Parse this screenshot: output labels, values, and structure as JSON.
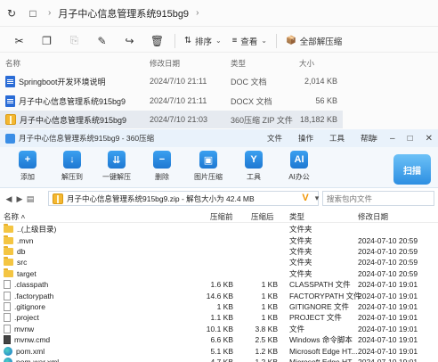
{
  "explorer": {
    "breadcrumb": [
      "月子中心信息管理系统915bg9"
    ],
    "toolbar": {
      "sort_label": "排序",
      "view_label": "查看",
      "extract_all_label": "全部解压缩"
    },
    "columns": [
      "名称",
      "修改日期",
      "类型",
      "大小"
    ],
    "files": [
      {
        "name": "Springboot开发环境说明",
        "date": "2024/7/10 21:11",
        "type": "DOC 文档",
        "size": "2,014 KB",
        "icon": "doc-icon"
      },
      {
        "name": "月子中心信息管理系统915bg9",
        "date": "2024/7/10 21:11",
        "type": "DOCX 文档",
        "size": "56 KB",
        "icon": "doc-icon"
      },
      {
        "name": "月子中心信息管理系统915bg9",
        "date": "2024/7/10 21:03",
        "type": "360压缩 ZIP 文件",
        "size": "18,182 KB",
        "icon": "zip-icon"
      }
    ]
  },
  "zipwin": {
    "title": "月子中心信息管理系统915bg9 - 360压缩",
    "menus": [
      "文件",
      "操作",
      "工具",
      "帮助"
    ],
    "tools": [
      "添加",
      "解压到",
      "一键解压",
      "删除",
      "图片压缩",
      "工具",
      "AI办公"
    ],
    "scan_label": "扫描",
    "path": "月子中心信息管理系统915bg9.zip - 解包大小为 42.4 MB",
    "search_placeholder": "搜索包内文件",
    "columns": [
      "名称",
      "压缩前",
      "压缩后",
      "类型",
      "修改日期"
    ],
    "rows": [
      {
        "name": "..(上级目录)",
        "before": "",
        "after": "",
        "type": "文件夹",
        "time": "",
        "kind": "folder"
      },
      {
        "name": ".mvn",
        "before": "",
        "after": "",
        "type": "文件夹",
        "time": "2024-07-10 20:59",
        "kind": "folder"
      },
      {
        "name": "db",
        "before": "",
        "after": "",
        "type": "文件夹",
        "time": "2024-07-10 20:59",
        "kind": "folder"
      },
      {
        "name": "src",
        "before": "",
        "after": "",
        "type": "文件夹",
        "time": "2024-07-10 20:59",
        "kind": "folder"
      },
      {
        "name": "target",
        "before": "",
        "after": "",
        "type": "文件夹",
        "time": "2024-07-10 20:59",
        "kind": "folder"
      },
      {
        "name": ".classpath",
        "before": "1.6 KB",
        "after": "1 KB",
        "type": "CLASSPATH 文件",
        "time": "2024-07-10 19:01",
        "kind": "file"
      },
      {
        "name": ".factorypath",
        "before": "14.6 KB",
        "after": "1 KB",
        "type": "FACTORYPATH 文件",
        "time": "2024-07-10 19:01",
        "kind": "file"
      },
      {
        "name": ".gitignore",
        "before": "1 KB",
        "after": "1 KB",
        "type": "GITIGNORE 文件",
        "time": "2024-07-10 19:01",
        "kind": "file"
      },
      {
        "name": ".project",
        "before": "1.1 KB",
        "after": "1 KB",
        "type": "PROJECT 文件",
        "time": "2024-07-10 19:01",
        "kind": "file"
      },
      {
        "name": "mvnw",
        "before": "10.1 KB",
        "after": "3.8 KB",
        "type": "文件",
        "time": "2024-07-10 19:01",
        "kind": "file"
      },
      {
        "name": "mvnw.cmd",
        "before": "6.6 KB",
        "after": "2.5 KB",
        "type": "Windows 命令脚本",
        "time": "2024-07-10 19:01",
        "kind": "cmd"
      },
      {
        "name": "pom.xml",
        "before": "5.1 KB",
        "after": "1.2 KB",
        "type": "Microsoft Edge HT...",
        "time": "2024-07-10 19:01",
        "kind": "edge"
      },
      {
        "name": "pom-war.xml",
        "before": "4.7 KB",
        "after": "1.2 KB",
        "type": "Microsoft Edge HT...",
        "time": "2024-07-10 19:01",
        "kind": "edge"
      }
    ]
  }
}
